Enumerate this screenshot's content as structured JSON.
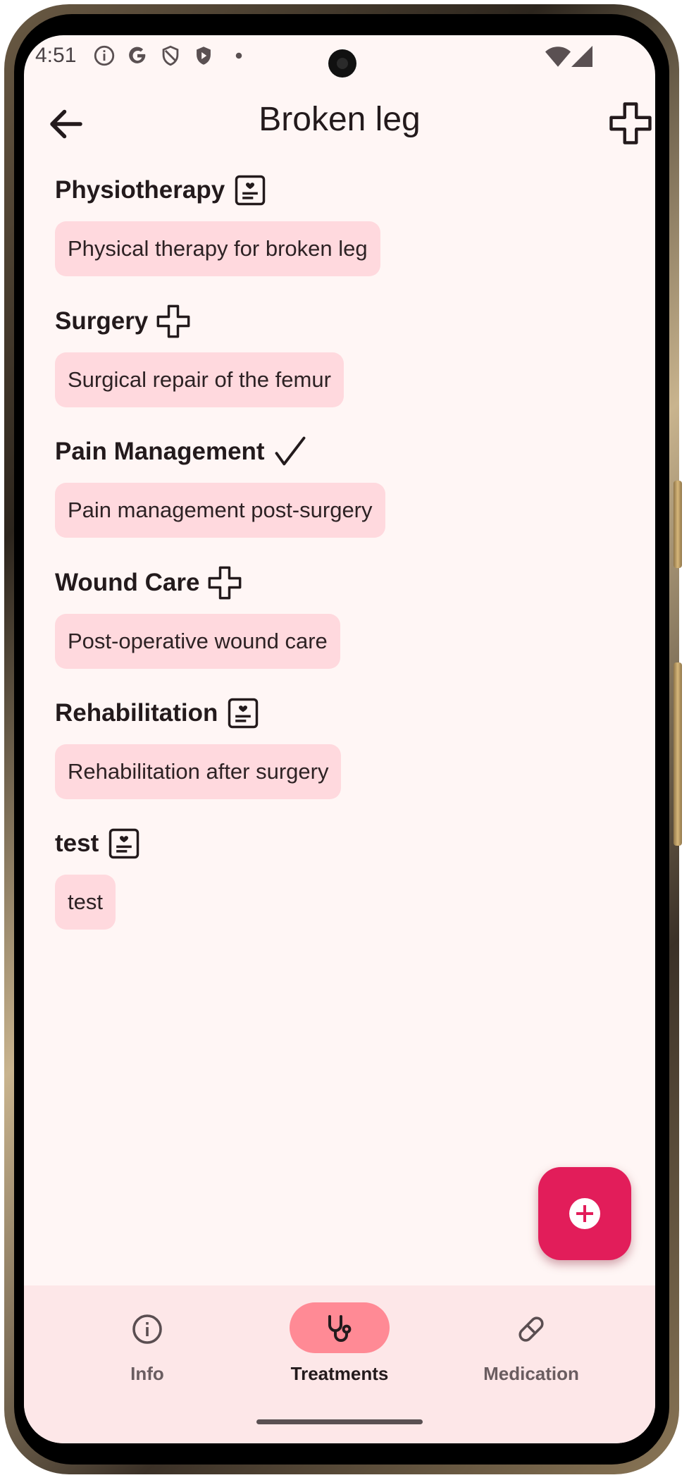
{
  "status_bar": {
    "time": "4:51",
    "icons": [
      "info-circle-icon",
      "google-icon",
      "shield-icon",
      "play-shield-icon",
      "dot-icon",
      "wifi-icon",
      "signal-icon"
    ]
  },
  "app_bar": {
    "title": "Broken leg",
    "back_icon": "arrow-left-icon",
    "action_icon": "medical-cross-icon"
  },
  "treatments": [
    {
      "name": "Physiotherapy",
      "icon": "medical-record-icon",
      "description": "Physical therapy for broken leg"
    },
    {
      "name": "Surgery",
      "icon": "medical-cross-icon",
      "description": "Surgical repair of the femur"
    },
    {
      "name": "Pain Management",
      "icon": "checkmark-icon",
      "description": "Pain management post-surgery"
    },
    {
      "name": "Wound Care",
      "icon": "medical-cross-icon",
      "description": "Post-operative wound care"
    },
    {
      "name": "Rehabilitation",
      "icon": "medical-record-icon",
      "description": "Rehabilitation after surgery"
    },
    {
      "name": "test",
      "icon": "medical-record-icon",
      "description": "test"
    }
  ],
  "fab": {
    "icon": "add-circle-icon"
  },
  "bottom_nav": {
    "items": [
      {
        "label": "Info",
        "icon": "info-icon",
        "active": false
      },
      {
        "label": "Treatments",
        "icon": "stethoscope-icon",
        "active": true
      },
      {
        "label": "Medication",
        "icon": "pill-icon",
        "active": false
      }
    ]
  },
  "colors": {
    "background": "#fff6f5",
    "chip": "#ffd9de",
    "fab": "#e21d5a",
    "nav_background": "#fde7e8",
    "nav_active_pill": "#ff8a95"
  }
}
